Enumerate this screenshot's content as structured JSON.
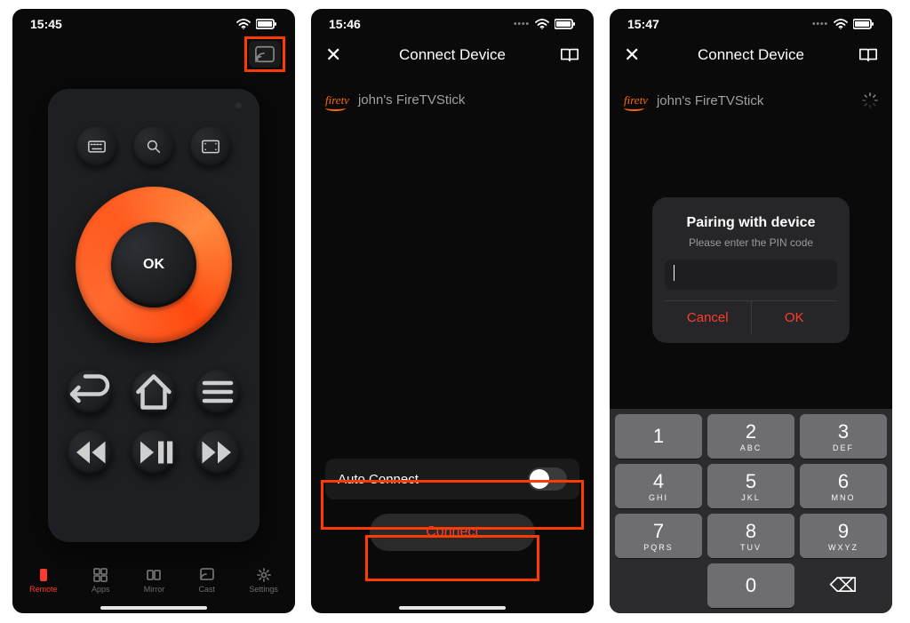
{
  "screens": {
    "s1": {
      "time": "15:45",
      "dpad_ok": "OK",
      "tabs": {
        "remote": "Remote",
        "apps": "Apps",
        "mirror": "Mirror",
        "cast": "Cast",
        "settings": "Settings"
      }
    },
    "s2": {
      "time": "15:46",
      "title": "Connect Device",
      "device_logo": "firetv",
      "device_name": "john's FireTVStick",
      "auto_connect_label": "Auto Connect",
      "auto_connect_on": false,
      "connect_label": "Connect"
    },
    "s3": {
      "time": "15:47",
      "title": "Connect Device",
      "device_logo": "firetv",
      "device_name": "john's FireTVStick",
      "loading": true,
      "dialog": {
        "heading": "Pairing with device",
        "sub": "Please enter the PIN code",
        "pin_value": "",
        "cancel": "Cancel",
        "ok": "OK"
      },
      "keypad": [
        {
          "n": "1",
          "l": ""
        },
        {
          "n": "2",
          "l": "ABC"
        },
        {
          "n": "3",
          "l": "DEF"
        },
        {
          "n": "4",
          "l": "GHI"
        },
        {
          "n": "5",
          "l": "JKL"
        },
        {
          "n": "6",
          "l": "MNO"
        },
        {
          "n": "7",
          "l": "PQRS"
        },
        {
          "n": "8",
          "l": "TUV"
        },
        {
          "n": "9",
          "l": "WXYZ"
        },
        {
          "n": "",
          "l": ""
        },
        {
          "n": "0",
          "l": ""
        },
        {
          "n": "⌫",
          "l": ""
        }
      ]
    }
  },
  "colors": {
    "accent": "#ff3b30",
    "highlight": "#ff3b00",
    "dpad_gradient": [
      "#ff5a1f",
      "#ff8a3f"
    ]
  }
}
